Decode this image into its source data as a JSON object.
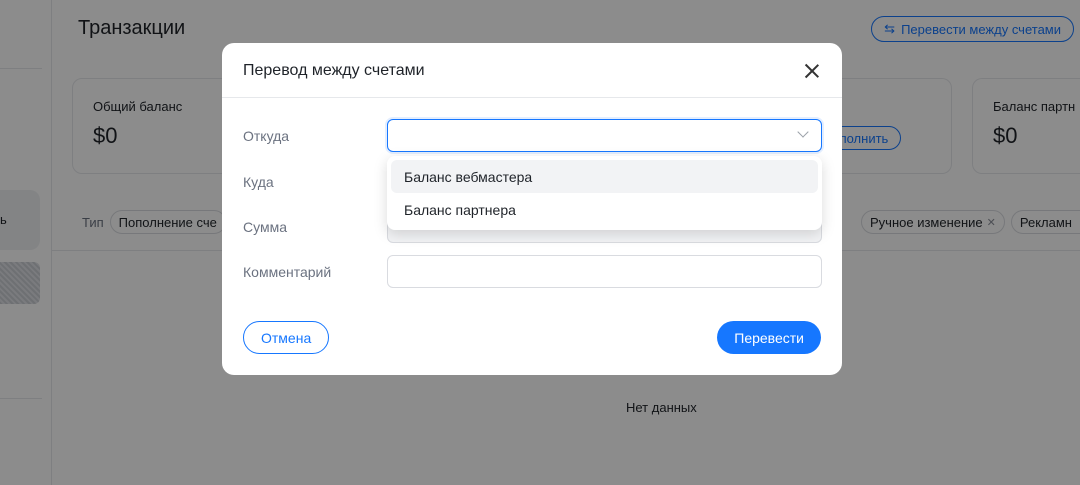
{
  "page": {
    "title": "Транзакции",
    "transfer_button": "Перевести между счетами",
    "sidebar_active_label": "ь",
    "no_data": "Нет данных"
  },
  "cards": {
    "total": {
      "label": "Общий баланс",
      "value": "$0"
    },
    "topup_button": "Пополнить",
    "partner": {
      "label": "Баланс партн",
      "value": "$0"
    }
  },
  "filters": {
    "type_label": "Тип",
    "chips": [
      "Пополнение сче",
      "Ручное изменение",
      "Рекламн"
    ]
  },
  "modal": {
    "title": "Перевод между счетами",
    "from_label": "Откуда",
    "to_label": "Куда",
    "amount_label": "Сумма",
    "comment_label": "Комментарий",
    "cancel": "Отмена",
    "submit": "Перевести",
    "dropdown_options": [
      "Баланс вебмастера",
      "Баланс партнера"
    ]
  },
  "colors": {
    "accent": "#1677ff",
    "overlay": "rgba(0,0,0,0.45)"
  },
  "icons": {
    "transfer": "swap-arrows-icon",
    "close": "close-icon",
    "dropdown": "chevron-down-icon"
  }
}
